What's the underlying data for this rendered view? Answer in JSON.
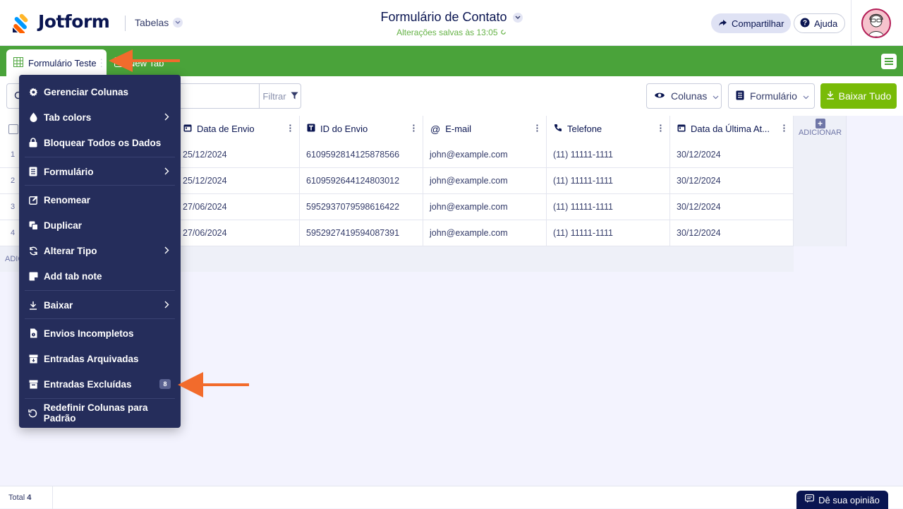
{
  "header": {
    "logo_text": "Jotform",
    "product_label": "Tabelas",
    "form_title": "Formulário de Contato",
    "saved_status": "Alterações salvas às 13:05",
    "share_label": "Compartilhar",
    "help_label": "Ajuda"
  },
  "tabs": {
    "active_label": "Formulário Teste",
    "new_tab_label": "New Tab"
  },
  "toolbar": {
    "search_placeholder": "",
    "filter_label": "Filtrar",
    "columns_label": "Colunas",
    "form_label": "Formulário",
    "download_all_label": "Baixar Tudo"
  },
  "table": {
    "columns": [
      {
        "label": "Data de Envio",
        "icon": "calendar-icon"
      },
      {
        "label": "ID do Envio",
        "icon": "text-icon"
      },
      {
        "label": "E-mail",
        "icon": "at-icon"
      },
      {
        "label": "Telefone",
        "icon": "phone-icon"
      },
      {
        "label": "Data da Última At...",
        "icon": "calendar-icon"
      }
    ],
    "add_column_label": "ADICIONAR",
    "add_row_label": "ADICIONAR",
    "rows": [
      {
        "num": "1",
        "date": "25/12/2024",
        "id": "6109592814125878566",
        "email": "john@example.com",
        "phone": "(11) 11111-1111",
        "updated": "30/12/2024"
      },
      {
        "num": "2",
        "date": "25/12/2024",
        "id": "6109592644124803012",
        "email": "john@example.com",
        "phone": "(11) 11111-1111",
        "updated": "30/12/2024"
      },
      {
        "num": "3",
        "date": "27/06/2024",
        "id": "5952937079598616422",
        "email": "john@example.com",
        "phone": "(11) 11111-1111",
        "updated": "30/12/2024"
      },
      {
        "num": "4",
        "date": "27/06/2024",
        "id": "5952927419594087391",
        "email": "john@example.com",
        "phone": "(11) 11111-1111",
        "updated": "30/12/2024"
      }
    ]
  },
  "menu": {
    "items": [
      {
        "label": "Gerenciar Colunas",
        "icon": "gear-icon"
      },
      {
        "label": "Tab colors",
        "icon": "drop-icon"
      },
      {
        "label": "Bloquear Todos os Dados",
        "icon": "lock-icon"
      },
      {
        "label": "Formulário",
        "icon": "form-icon"
      },
      {
        "label": "Renomear",
        "icon": "edit-icon"
      },
      {
        "label": "Duplicar",
        "icon": "copy-icon"
      },
      {
        "label": "Alterar Tipo",
        "icon": "refresh-icon"
      },
      {
        "label": "Add tab note",
        "icon": "note-icon"
      },
      {
        "label": "Baixar",
        "icon": "download-icon"
      },
      {
        "label": "Envios Incompletos",
        "icon": "file-clock-icon"
      },
      {
        "label": "Entradas Arquivadas",
        "icon": "archive-icon"
      },
      {
        "label": "Entradas Excluídas",
        "icon": "trash-box-icon"
      },
      {
        "label": "Redefinir Colunas para Padrão",
        "icon": "reset-icon"
      }
    ],
    "deleted_count": "8"
  },
  "footer": {
    "total_label": "Total",
    "total_value": "4",
    "feedback_label": "Dê sua opinião"
  },
  "colors": {
    "brand_green": "#4aa33a",
    "download_green": "#78bb07",
    "menu_bg": "#252d5b",
    "annotation_arrow": "#f26b2c"
  }
}
